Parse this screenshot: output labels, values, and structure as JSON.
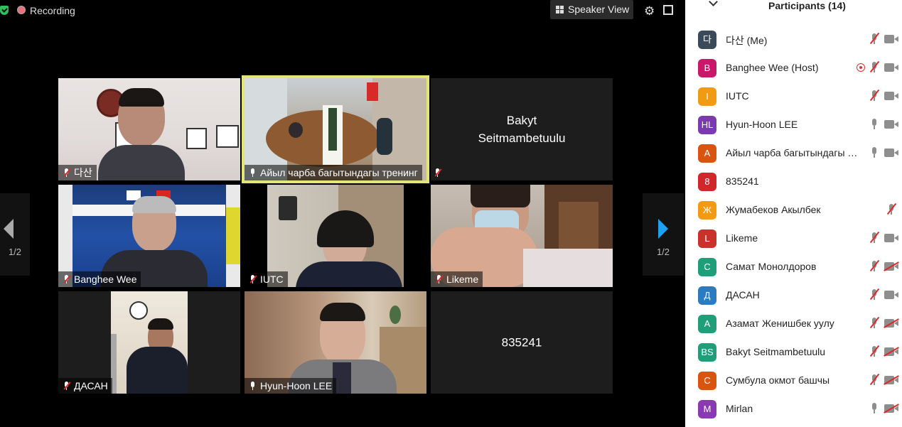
{
  "recording": {
    "label": "Recording"
  },
  "toolbar": {
    "speaker_view_label": "Speaker View"
  },
  "tiles": [
    {
      "label": "다산",
      "muted": true
    },
    {
      "label": "Айыл чарба багытындагы тренинг",
      "muted": false
    },
    {
      "name": "Bakyt Seitmambetuulu",
      "muted": true
    },
    {
      "label": "Banghee Wee",
      "muted": true
    },
    {
      "label": "IUTC",
      "muted": true
    },
    {
      "label": "Likeme",
      "muted": true
    },
    {
      "label": "ДАСАН",
      "muted": true
    },
    {
      "label": "Hyun-Hoon LEE",
      "muted": false
    },
    {
      "name": "835241"
    }
  ],
  "pagination": {
    "left_page": "1/2",
    "right_page": "1/2"
  },
  "participants": {
    "title": "Participants (14)",
    "items": [
      {
        "initials": "다",
        "name": "다산 (Me)",
        "color": "#3b4a5a",
        "mic_muted": true,
        "cam_off": false
      },
      {
        "initials": "B",
        "name": "Banghee Wee (Host)",
        "color": "#c8186a",
        "mic_muted": true,
        "cam_off": false,
        "recording": true
      },
      {
        "initials": "I",
        "name": "IUTC",
        "color": "#f29b12",
        "mic_muted": true,
        "cam_off": false
      },
      {
        "initials": "HL",
        "name": "Hyun-Hoon LEE",
        "color": "#7b3ab0",
        "mic_muted": false,
        "cam_off": false
      },
      {
        "initials": "А",
        "name": "Айыл чарба багытындагы тренинг",
        "color": "#d9540f",
        "mic_muted": false,
        "cam_off": false
      },
      {
        "initials": "8",
        "name": "835241",
        "color": "#d0272a",
        "mic_muted": null,
        "cam_off": null
      },
      {
        "initials": "Ж",
        "name": "Жумабеков Акылбек",
        "color": "#f29b12",
        "mic_muted": true,
        "cam_off": null
      },
      {
        "initials": "L",
        "name": "Likeme",
        "color": "#c8322a",
        "mic_muted": true,
        "cam_off": false
      },
      {
        "initials": "С",
        "name": "Самат Монолдоров",
        "color": "#1f9e7a",
        "mic_muted": true,
        "cam_off": true
      },
      {
        "initials": "Д",
        "name": "ДАСАН",
        "color": "#2a7bc0",
        "mic_muted": true,
        "cam_off": false
      },
      {
        "initials": "А",
        "name": "Азамат Женишбек уулу",
        "color": "#1f9e7a",
        "mic_muted": true,
        "cam_off": true
      },
      {
        "initials": "BS",
        "name": "Bakyt Seitmambetuulu",
        "color": "#1f9e7a",
        "mic_muted": true,
        "cam_off": true
      },
      {
        "initials": "С",
        "name": "Сумбула окмот башчы",
        "color": "#d9540f",
        "mic_muted": true,
        "cam_off": true
      },
      {
        "initials": "M",
        "name": "Mirlan",
        "color": "#8a3ab0",
        "mic_muted": false,
        "cam_off": true
      }
    ]
  }
}
